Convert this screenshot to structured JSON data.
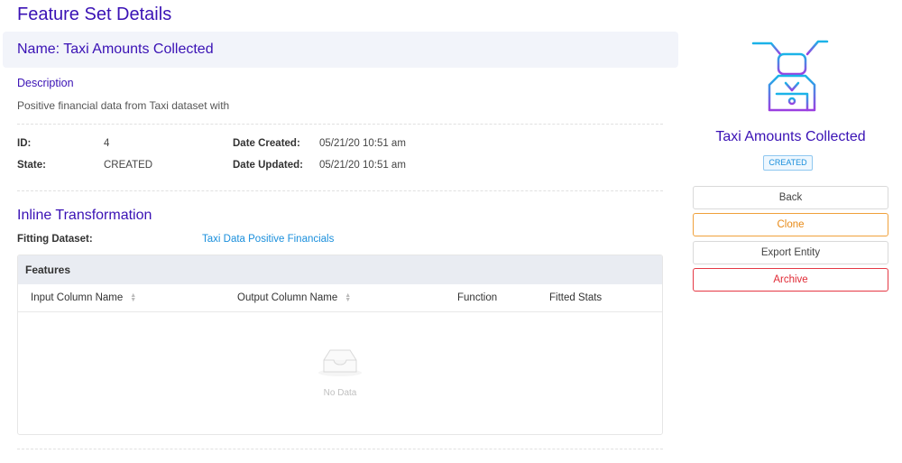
{
  "page": {
    "title": "Feature Set Details"
  },
  "header": {
    "name_label": "Name: Taxi Amounts Collected"
  },
  "description": {
    "label": "Description",
    "text": "Positive financial data from Taxi dataset with"
  },
  "meta": {
    "id_label": "ID:",
    "id_value": "4",
    "state_label": "State:",
    "state_value": "CREATED",
    "created_label": "Date Created:",
    "created_value": "05/21/20 10:51 am",
    "updated_label": "Date Updated:",
    "updated_value": "05/21/20 10:51 am"
  },
  "transformation": {
    "title": "Inline Transformation",
    "fitting_label": "Fitting Dataset:",
    "fitting_link": "Taxi Data Positive Financials"
  },
  "features_table": {
    "title": "Features",
    "columns": [
      "Input Column Name",
      "Output Column Name",
      "Function",
      "Fitted Stats"
    ],
    "empty_text": "No Data",
    "rows": []
  },
  "sidebar": {
    "entity_name": "Taxi Amounts Collected",
    "status": "CREATED",
    "logo_icon": "robot-icon",
    "buttons": {
      "back": "Back",
      "clone": "Clone",
      "export": "Export Entity",
      "archive": "Archive"
    }
  },
  "colors": {
    "accent": "#3a12b5",
    "link": "#1a8fdc",
    "clone": "#f0a13b",
    "archive": "#e53945"
  }
}
